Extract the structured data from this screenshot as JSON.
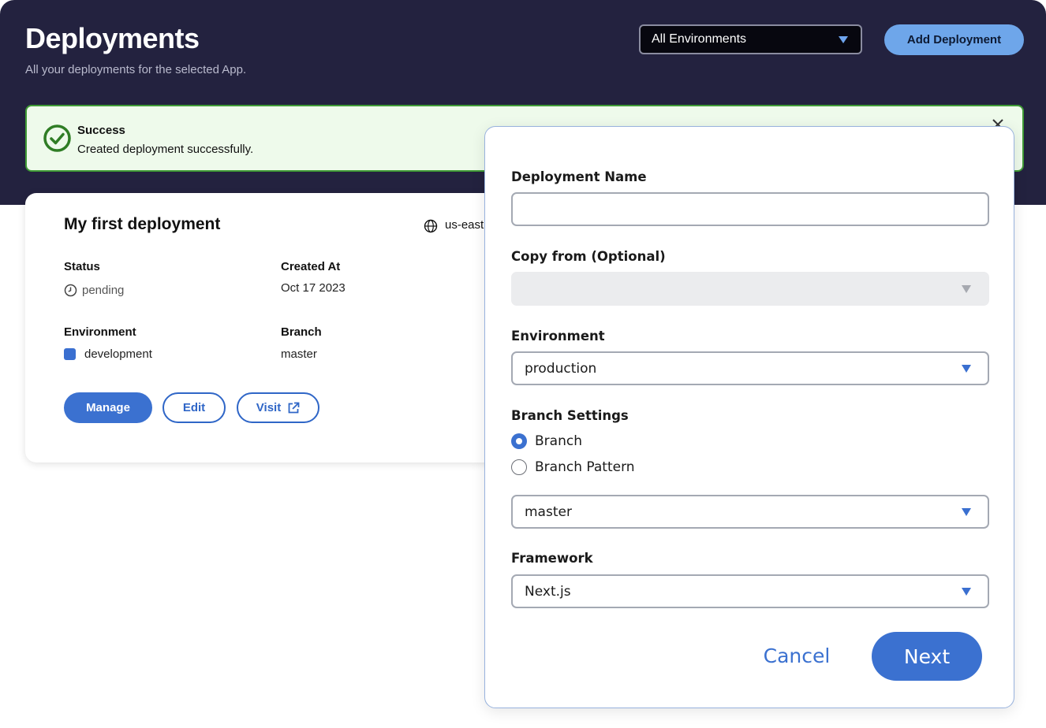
{
  "header": {
    "title": "Deployments",
    "subtitle": "All your deployments for the selected App.",
    "environment_filter": "All Environments",
    "add_button": "Add Deployment"
  },
  "alert": {
    "title": "Success",
    "message": "Created deployment successfully."
  },
  "card": {
    "title": "My first deployment",
    "region": "us-east",
    "status_label": "Status",
    "status_value": "pending",
    "created_label": "Created At",
    "created_value": "Oct 17 2023",
    "environment_label": "Environment",
    "environment_value": "development",
    "environment_color": "#3a6fd0",
    "branch_label": "Branch",
    "branch_value": "master",
    "manage_button": "Manage",
    "edit_button": "Edit",
    "visit_button": "Visit"
  },
  "dialog": {
    "name_label": "Deployment Name",
    "name_value": "",
    "copy_label": "Copy from (Optional)",
    "copy_value": "",
    "environment_label": "Environment",
    "environment_value": "production",
    "branch_settings_label": "Branch Settings",
    "radio_branch": "Branch",
    "radio_branch_pattern": "Branch Pattern",
    "selected_radio": "Branch",
    "branch_value": "master",
    "framework_label": "Framework",
    "framework_value": "Next.js",
    "cancel_button": "Cancel",
    "next_button": "Next"
  },
  "icons": {
    "alert": "check-circle-icon",
    "close": "close-icon",
    "region": "globe-icon",
    "status": "clock-icon",
    "visit": "external-link-icon",
    "dropdown": "caret-down-icon"
  },
  "colors": {
    "header_bg": "#23223f",
    "primary": "#3b71d0",
    "success": "#3f9a35",
    "success_bg": "#eefaeb"
  }
}
